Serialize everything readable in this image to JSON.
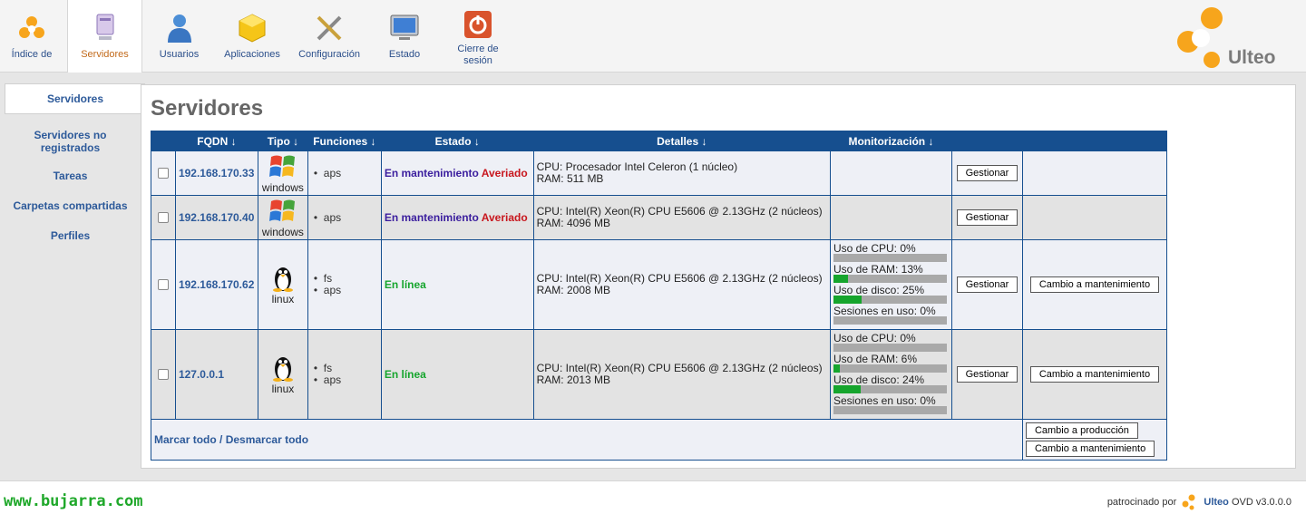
{
  "nav": {
    "items": [
      {
        "label": "Índice de",
        "icon": "home-icon"
      },
      {
        "label": "Servidores",
        "icon": "server-icon"
      },
      {
        "label": "Usuarios",
        "icon": "user-icon"
      },
      {
        "label": "Aplicaciones",
        "icon": "cube-icon"
      },
      {
        "label": "Configuración",
        "icon": "tools-icon"
      },
      {
        "label": "Estado",
        "icon": "monitor-icon"
      },
      {
        "label": "Cierre de sesión",
        "icon": "power-icon"
      }
    ],
    "active": "Servidores"
  },
  "brand": {
    "name": "Ulteo",
    "accent": "#f7a51c"
  },
  "sidebar": {
    "items": [
      {
        "label": "Servidores",
        "active": true
      },
      {
        "label": "Servidores no registrados"
      },
      {
        "label": "Tareas"
      },
      {
        "label": "Carpetas compartidas"
      },
      {
        "label": "Perfiles"
      }
    ]
  },
  "page": {
    "title": "Servidores"
  },
  "table": {
    "columns": [
      "FQDN ↓",
      "Tipo ↓",
      "Funciones ↓",
      "Estado ↓",
      "Detalles ↓",
      "Monitorización ↓"
    ],
    "rows": [
      {
        "fqdn": "192.168.170.33",
        "type": "windows",
        "functions": [
          "aps"
        ],
        "status_main": "En mantenimiento",
        "status_extra": "Averiado",
        "details": [
          "CPU: Procesador Intel Celeron (1 núcleo)",
          "RAM: 511 MB"
        ],
        "monitoring": null,
        "manage": "Gestionar",
        "maint": ""
      },
      {
        "fqdn": "192.168.170.40",
        "type": "windows",
        "functions": [
          "aps"
        ],
        "status_main": "En mantenimiento",
        "status_extra": "Averiado",
        "details": [
          "CPU: Intel(R) Xeon(R) CPU E5606 @ 2.13GHz (2 núcleos)",
          "RAM: 4096 MB"
        ],
        "monitoring": null,
        "manage": "Gestionar",
        "maint": ""
      },
      {
        "fqdn": "192.168.170.62",
        "type": "linux",
        "functions": [
          "fs",
          "aps"
        ],
        "status_main": "En línea",
        "status_extra": "",
        "details": [
          "CPU: Intel(R) Xeon(R) CPU E5606 @ 2.13GHz (2 núcleos)",
          "RAM: 2008 MB"
        ],
        "monitoring": {
          "cpu": "Uso de CPU: 0%",
          "cpu_pct": 0,
          "ram": "Uso de RAM: 13%",
          "ram_pct": 13,
          "disk": "Uso de disco: 25%",
          "disk_pct": 25,
          "sessions": "Sesiones en uso: 0%",
          "sessions_pct": 0
        },
        "manage": "Gestionar",
        "maint": "Cambio a mantenimiento"
      },
      {
        "fqdn": "127.0.0.1",
        "type": "linux",
        "functions": [
          "fs",
          "aps"
        ],
        "status_main": "En línea",
        "status_extra": "",
        "details": [
          "CPU: Intel(R) Xeon(R) CPU E5606 @ 2.13GHz (2 núcleos)",
          "RAM: 2013 MB"
        ],
        "monitoring": {
          "cpu": "Uso de CPU: 0%",
          "cpu_pct": 0,
          "ram": "Uso de RAM: 6%",
          "ram_pct": 6,
          "disk": "Uso de disco: 24%",
          "disk_pct": 24,
          "sessions": "Sesiones en uso: 0%",
          "sessions_pct": 0
        },
        "manage": "Gestionar",
        "maint": "Cambio a mantenimiento"
      }
    ],
    "footer": {
      "mark_all": "Marcar todo",
      "separator": " / ",
      "unmark_all": "Desmarcar todo",
      "to_production": "Cambio a producción",
      "to_maintenance": "Cambio a mantenimiento"
    }
  },
  "footer": {
    "watermark": "www.bujarra.com",
    "sponsor_prefix": "patrocinado por",
    "sponsor_name": "Ulteo",
    "sponsor_suffix": "OVD v3.0.0.0"
  },
  "colors": {
    "header": "#164f8f",
    "online": "#16a52d",
    "maintenance": "#3b1e9e",
    "failed": "#c8171e",
    "link": "#2d5a9a"
  }
}
